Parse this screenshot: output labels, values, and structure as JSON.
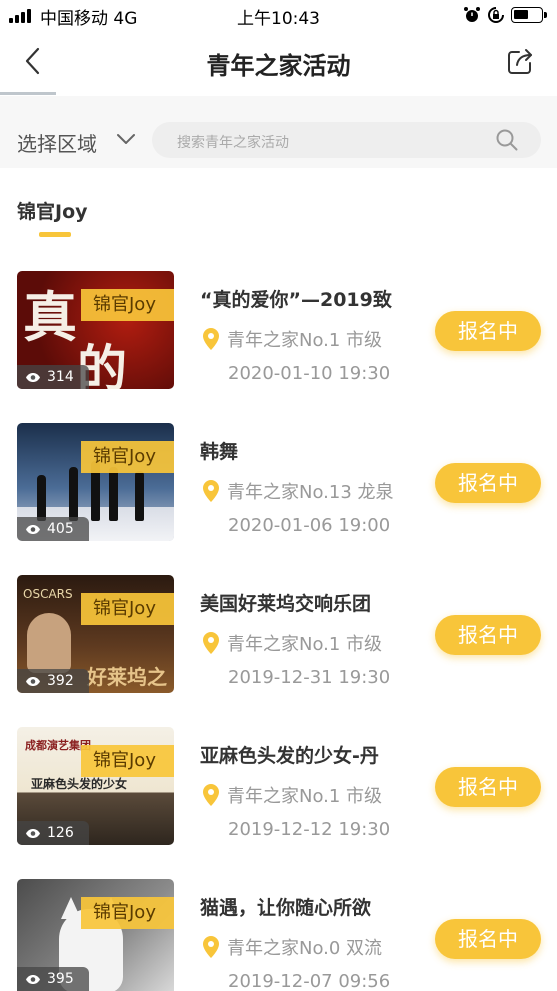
{
  "status": {
    "carrier": "中国移动 4G",
    "time": "上午10:43"
  },
  "nav": {
    "title": "青年之家活动"
  },
  "filter": {
    "region_label": "选择区域",
    "search_placeholder": "搜索青年之家活动"
  },
  "tabs": [
    {
      "label": "锦官Joy",
      "active": true
    }
  ],
  "colors": {
    "accent": "#f8c53a"
  },
  "activities": [
    {
      "tag": "锦官Joy",
      "views": "314",
      "title": "“真的爱你”—2019致",
      "location": "青年之家No.1 市级",
      "date": "2020-01-10 19:30",
      "button": "报名中",
      "thumb_text": [
        "真",
        "的"
      ]
    },
    {
      "tag": "锦官Joy",
      "views": "405",
      "title": "韩舞",
      "location": "青年之家No.13 龙泉",
      "date": "2020-01-06 19:00",
      "button": "报名中"
    },
    {
      "tag": "锦官Joy",
      "views": "392",
      "title": "美国好莱坞交响乐团",
      "location": "青年之家No.1 市级",
      "date": "2019-12-31 19:30",
      "button": "报名中",
      "thumb_text": [
        "OSCARS",
        "好莱坞之夜"
      ]
    },
    {
      "tag": "锦官Joy",
      "views": "126",
      "title": "亚麻色头发的少女-丹",
      "location": "青年之家No.1 市级",
      "date": "2019-12-12 19:30",
      "button": "报名中",
      "thumb_text": [
        "成都演艺集团",
        "亚麻色头发的少女"
      ]
    },
    {
      "tag": "锦官Joy",
      "views": "395",
      "title": "猫遇，让你随心所欲",
      "location": "青年之家No.0 双流",
      "date": "2019-12-07 09:56",
      "button": "报名中"
    }
  ]
}
